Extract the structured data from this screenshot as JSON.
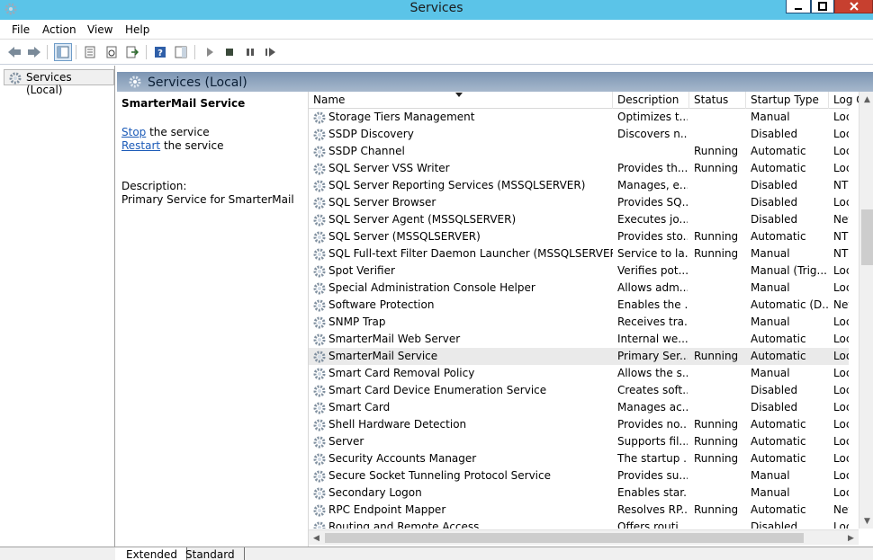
{
  "window": {
    "title": "Services"
  },
  "menu": [
    "File",
    "Action",
    "View",
    "Help"
  ],
  "tree": {
    "root_label": "Services (Local)"
  },
  "banner": {
    "title": "Services (Local)"
  },
  "details": {
    "service_name": "SmarterMail Service",
    "stop_link": "Stop",
    "stop_suffix": " the service",
    "restart_link": "Restart",
    "restart_suffix": " the service",
    "description_label": "Description:",
    "description_text": "Primary Service for SmarterMail"
  },
  "columns": [
    "Name",
    "Description",
    "Status",
    "Startup Type",
    "Log O"
  ],
  "rows": [
    {
      "name": "Storage Tiers Management",
      "description": "Optimizes t...",
      "status": "",
      "startup": "Manual",
      "logon": "Local"
    },
    {
      "name": "SSDP Discovery",
      "description": "Discovers n...",
      "status": "",
      "startup": "Disabled",
      "logon": "Local"
    },
    {
      "name": "SSDP Channel",
      "description": "",
      "status": "Running",
      "startup": "Automatic",
      "logon": "Local"
    },
    {
      "name": "SQL Server VSS Writer",
      "description": "Provides th...",
      "status": "Running",
      "startup": "Automatic",
      "logon": "Local"
    },
    {
      "name": "SQL Server Reporting Services (MSSQLSERVER)",
      "description": "Manages, e...",
      "status": "",
      "startup": "Disabled",
      "logon": "NT Se"
    },
    {
      "name": "SQL Server Browser",
      "description": "Provides SQ...",
      "status": "",
      "startup": "Disabled",
      "logon": "Local"
    },
    {
      "name": "SQL Server Agent (MSSQLSERVER)",
      "description": "Executes jo...",
      "status": "",
      "startup": "Disabled",
      "logon": "Netw"
    },
    {
      "name": "SQL Server (MSSQLSERVER)",
      "description": "Provides sto...",
      "status": "Running",
      "startup": "Automatic",
      "logon": "NT Se"
    },
    {
      "name": "SQL Full-text Filter Daemon Launcher (MSSQLSERVER)",
      "description": "Service to la...",
      "status": "Running",
      "startup": "Manual",
      "logon": "NT Se"
    },
    {
      "name": "Spot Verifier",
      "description": "Verifies pot...",
      "status": "",
      "startup": "Manual (Trig...",
      "logon": "Local"
    },
    {
      "name": "Special Administration Console Helper",
      "description": "Allows adm...",
      "status": "",
      "startup": "Manual",
      "logon": "Local"
    },
    {
      "name": "Software Protection",
      "description": "Enables the ...",
      "status": "",
      "startup": "Automatic (D...",
      "logon": "Netw"
    },
    {
      "name": "SNMP Trap",
      "description": "Receives tra...",
      "status": "",
      "startup": "Manual",
      "logon": "Local"
    },
    {
      "name": "SmarterMail Web Server",
      "description": "Internal we...",
      "status": "",
      "startup": "Automatic",
      "logon": "Local"
    },
    {
      "name": "SmarterMail Service",
      "description": "Primary Ser...",
      "status": "Running",
      "startup": "Automatic",
      "logon": "Local",
      "selected": true
    },
    {
      "name": "Smart Card Removal Policy",
      "description": "Allows the s...",
      "status": "",
      "startup": "Manual",
      "logon": "Local"
    },
    {
      "name": "Smart Card Device Enumeration Service",
      "description": "Creates soft...",
      "status": "",
      "startup": "Disabled",
      "logon": "Local"
    },
    {
      "name": "Smart Card",
      "description": "Manages ac...",
      "status": "",
      "startup": "Disabled",
      "logon": "Local"
    },
    {
      "name": "Shell Hardware Detection",
      "description": "Provides no...",
      "status": "Running",
      "startup": "Automatic",
      "logon": "Local"
    },
    {
      "name": "Server",
      "description": "Supports fil...",
      "status": "Running",
      "startup": "Automatic",
      "logon": "Local"
    },
    {
      "name": "Security Accounts Manager",
      "description": "The startup ...",
      "status": "Running",
      "startup": "Automatic",
      "logon": "Local"
    },
    {
      "name": "Secure Socket Tunneling Protocol Service",
      "description": "Provides su...",
      "status": "",
      "startup": "Manual",
      "logon": "Local"
    },
    {
      "name": "Secondary Logon",
      "description": "Enables star...",
      "status": "",
      "startup": "Manual",
      "logon": "Local"
    },
    {
      "name": "RPC Endpoint Mapper",
      "description": "Resolves RP...",
      "status": "Running",
      "startup": "Automatic",
      "logon": "Netw"
    },
    {
      "name": "Routing and Remote Access",
      "description": "Offers routi...",
      "status": "",
      "startup": "Disabled",
      "logon": "Local"
    }
  ],
  "tabs": [
    "Extended",
    "Standard"
  ],
  "colors": {
    "titlebar": "#5bc4e8",
    "close": "#c7402f",
    "link": "#1c5bb8",
    "selected_row": "#eaeaea"
  }
}
